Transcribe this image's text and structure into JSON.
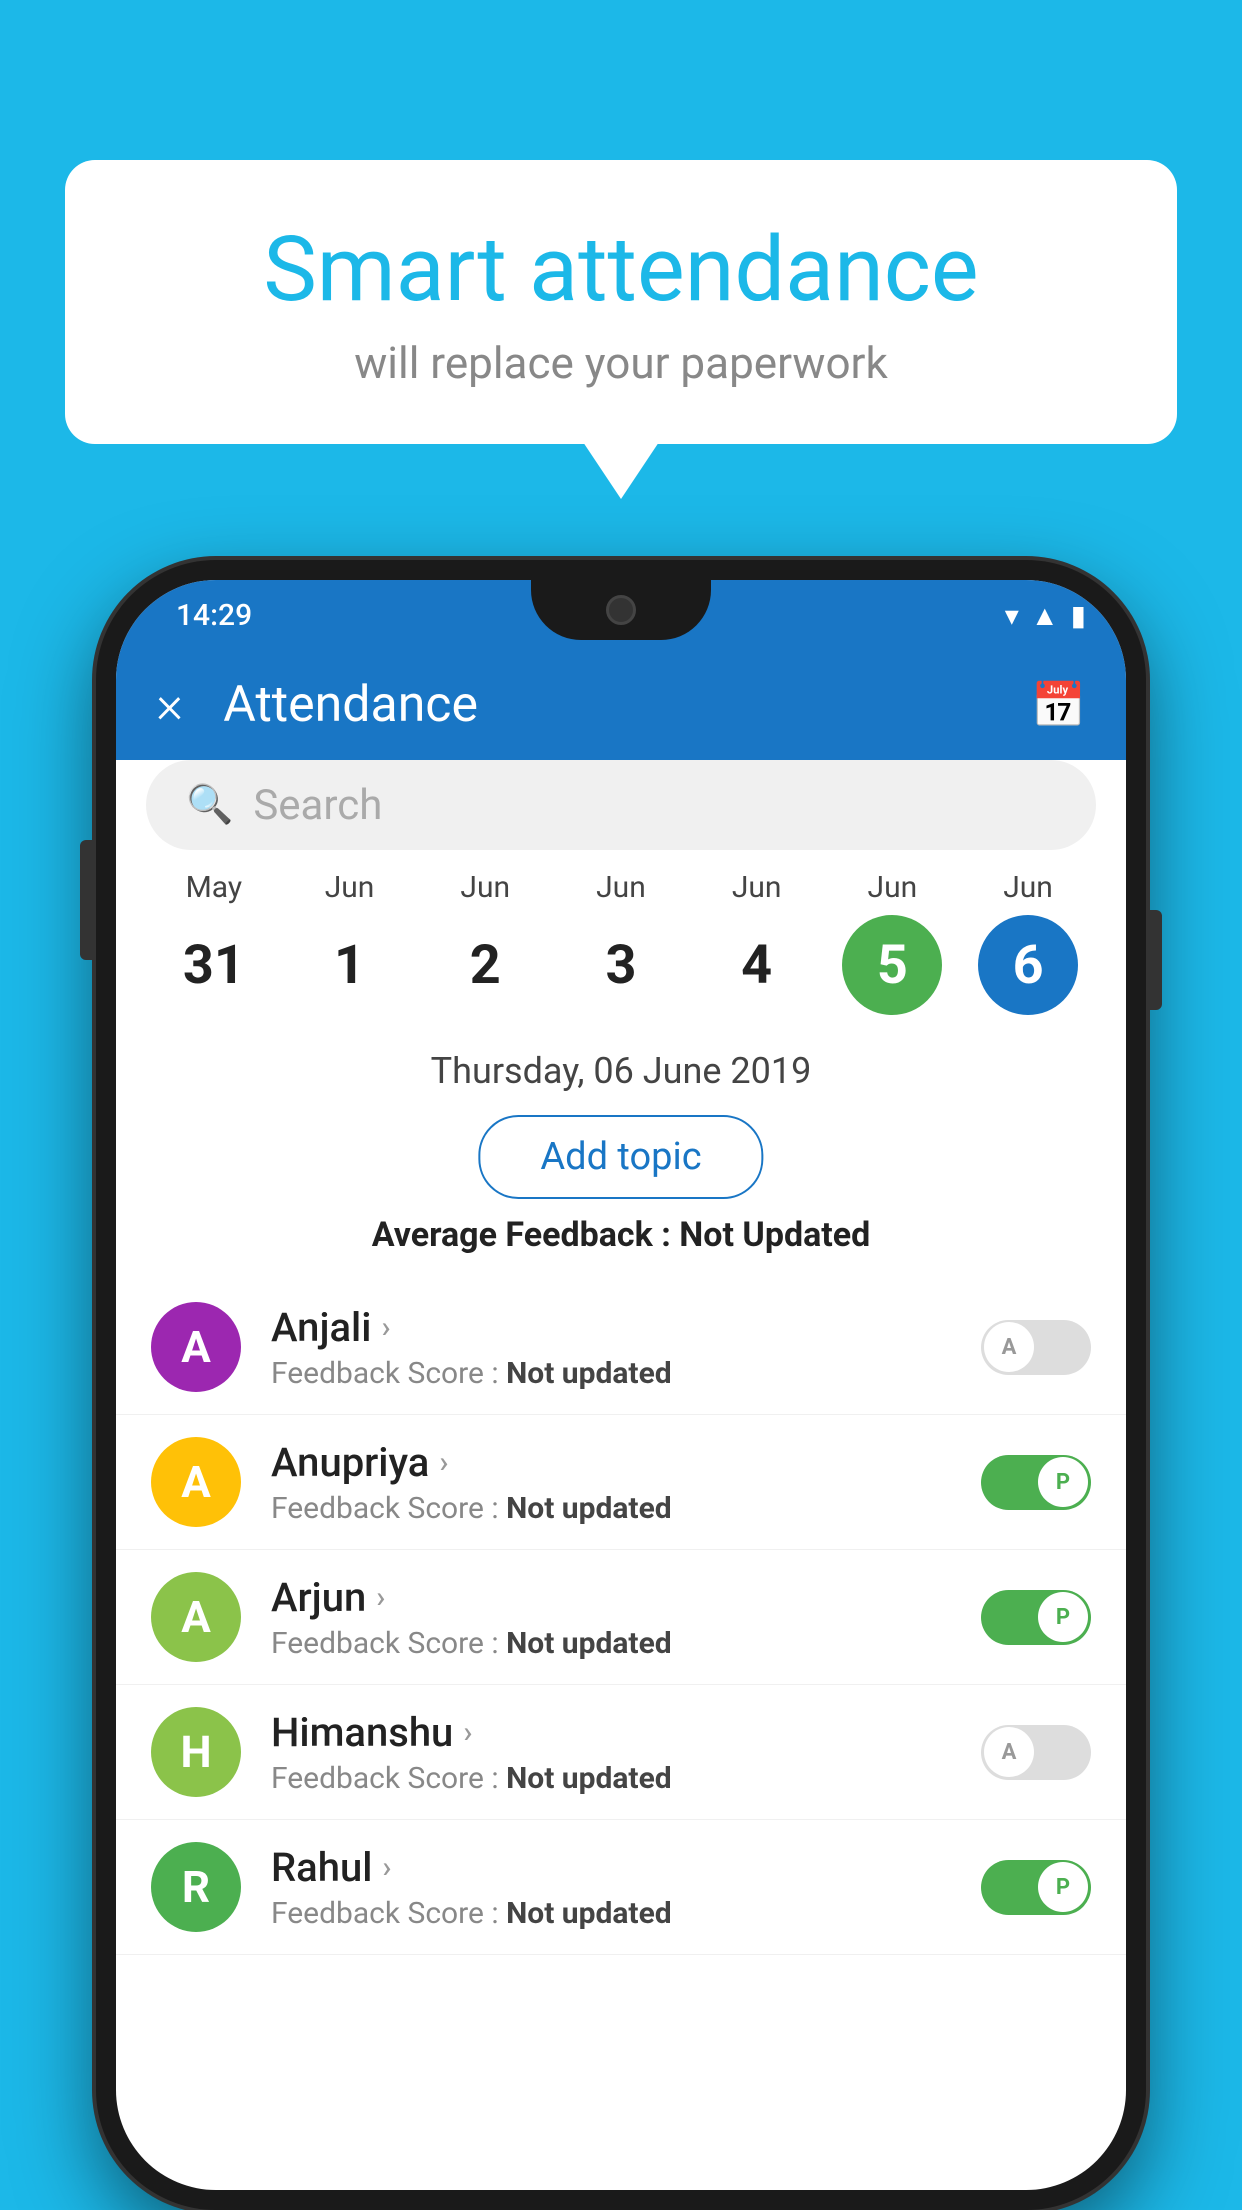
{
  "background_color": "#1cb8e8",
  "bubble": {
    "title": "Smart attendance",
    "subtitle": "will replace your paperwork"
  },
  "phone": {
    "status_bar": {
      "time": "14:29"
    },
    "app_bar": {
      "title": "Attendance",
      "close_label": "×",
      "calendar_icon": "📅"
    },
    "search": {
      "placeholder": "Search"
    },
    "calendar": {
      "days": [
        {
          "month": "May",
          "date": "31",
          "style": "normal"
        },
        {
          "month": "Jun",
          "date": "1",
          "style": "normal"
        },
        {
          "month": "Jun",
          "date": "2",
          "style": "normal"
        },
        {
          "month": "Jun",
          "date": "3",
          "style": "normal"
        },
        {
          "month": "Jun",
          "date": "4",
          "style": "normal"
        },
        {
          "month": "Jun",
          "date": "5",
          "style": "green"
        },
        {
          "month": "Jun",
          "date": "6",
          "style": "blue"
        }
      ]
    },
    "selected_date": "Thursday, 06 June 2019",
    "add_topic_label": "Add topic",
    "avg_feedback_prefix": "Average Feedback : ",
    "avg_feedback_value": "Not Updated",
    "students": [
      {
        "name": "Anjali",
        "initial": "A",
        "avatar_class": "avatar-purple",
        "feedback_label": "Feedback Score : ",
        "feedback_value": "Not updated",
        "toggle_state": "off",
        "toggle_letter": "A"
      },
      {
        "name": "Anupriya",
        "initial": "A",
        "avatar_class": "avatar-yellow",
        "feedback_label": "Feedback Score : ",
        "feedback_value": "Not updated",
        "toggle_state": "on",
        "toggle_letter": "P"
      },
      {
        "name": "Arjun",
        "initial": "A",
        "avatar_class": "avatar-light-green",
        "feedback_label": "Feedback Score : ",
        "feedback_value": "Not updated",
        "toggle_state": "on",
        "toggle_letter": "P"
      },
      {
        "name": "Himanshu",
        "initial": "H",
        "avatar_class": "avatar-light-green2",
        "feedback_label": "Feedback Score : ",
        "feedback_value": "Not updated",
        "toggle_state": "off",
        "toggle_letter": "A"
      },
      {
        "name": "Rahul",
        "initial": "R",
        "avatar_class": "avatar-green3",
        "feedback_label": "Feedback Score : ",
        "feedback_value": "Not updated",
        "toggle_state": "on",
        "toggle_letter": "P"
      }
    ]
  }
}
